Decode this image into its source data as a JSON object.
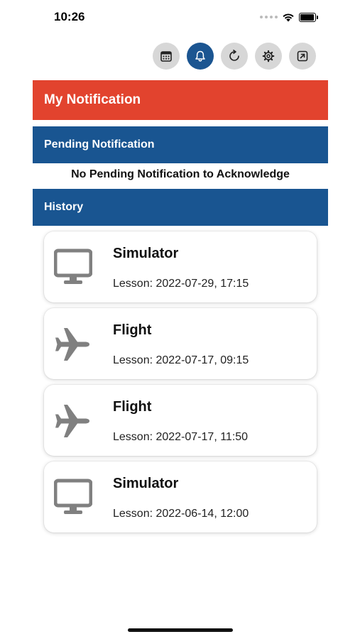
{
  "status_bar": {
    "time": "10:26"
  },
  "toolbar": {
    "buttons": [
      {
        "icon": "calendar-icon",
        "active": false
      },
      {
        "icon": "bell-icon",
        "active": true
      },
      {
        "icon": "refresh-icon",
        "active": false
      },
      {
        "icon": "gear-icon",
        "active": false
      },
      {
        "icon": "external-link-icon",
        "active": false
      }
    ]
  },
  "header": {
    "title": "My Notification"
  },
  "pending": {
    "title": "Pending Notification",
    "empty_message": "No Pending Notification to Acknowledge"
  },
  "history": {
    "title": "History",
    "items": [
      {
        "icon": "monitor-icon",
        "title": "Simulator",
        "subtitle": "Lesson: 2022-07-29, 17:15"
      },
      {
        "icon": "airplane-icon",
        "title": "Flight",
        "subtitle": "Lesson: 2022-07-17, 09:15"
      },
      {
        "icon": "airplane-icon",
        "title": "Flight",
        "subtitle": "Lesson: 2022-07-17, 11:50"
      },
      {
        "icon": "monitor-icon",
        "title": "Simulator",
        "subtitle": "Lesson: 2022-06-14, 12:00"
      }
    ]
  },
  "colors": {
    "red": "#e2432e",
    "blue": "#195591",
    "active_button": "#1b5591",
    "icon_gray": "#808080"
  }
}
